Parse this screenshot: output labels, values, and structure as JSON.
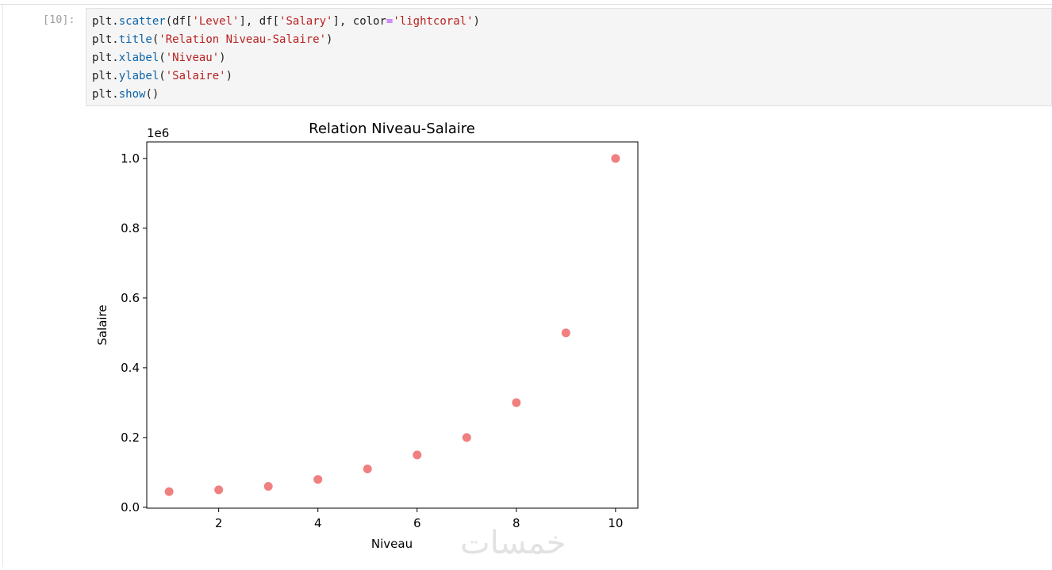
{
  "cell": {
    "prompt": "[10]:",
    "lines": [
      [
        [
          "plt.",
          "plain"
        ],
        [
          "scatter",
          "fn"
        ],
        [
          "(df[",
          "plain"
        ],
        [
          "'Level'",
          "str"
        ],
        [
          "], df[",
          "plain"
        ],
        [
          "'Salary'",
          "str"
        ],
        [
          "], color",
          "plain"
        ],
        [
          "=",
          "op"
        ],
        [
          "'lightcoral'",
          "str"
        ],
        [
          ")",
          "plain"
        ]
      ],
      [
        [
          "plt.",
          "plain"
        ],
        [
          "title",
          "fn"
        ],
        [
          "(",
          "plain"
        ],
        [
          "'Relation Niveau-Salaire'",
          "str"
        ],
        [
          ")",
          "plain"
        ]
      ],
      [
        [
          "plt.",
          "plain"
        ],
        [
          "xlabel",
          "fn"
        ],
        [
          "(",
          "plain"
        ],
        [
          "'Niveau'",
          "str"
        ],
        [
          ")",
          "plain"
        ]
      ],
      [
        [
          "plt.",
          "plain"
        ],
        [
          "ylabel",
          "fn"
        ],
        [
          "(",
          "plain"
        ],
        [
          "'Salaire'",
          "str"
        ],
        [
          ")",
          "plain"
        ]
      ],
      [
        [
          "plt.",
          "plain"
        ],
        [
          "show",
          "fn"
        ],
        [
          "()",
          "plain"
        ]
      ]
    ]
  },
  "chart_data": {
    "type": "scatter",
    "title": "Relation Niveau-Salaire",
    "xlabel": "Niveau",
    "ylabel": "Salaire",
    "y_offset_label": "1e6",
    "x": [
      1,
      2,
      3,
      4,
      5,
      6,
      7,
      8,
      9,
      10
    ],
    "y": [
      45000,
      50000,
      60000,
      80000,
      110000,
      150000,
      200000,
      300000,
      500000,
      1000000
    ],
    "color": "#f08080",
    "xlim": [
      0.55,
      10.45
    ],
    "ylim": [
      -0.0025,
      1.0475
    ],
    "xticks": [
      2,
      4,
      6,
      8,
      10
    ],
    "xtick_labels": [
      "2",
      "4",
      "6",
      "8",
      "10"
    ],
    "yticks": [
      0.0,
      0.2,
      0.4,
      0.6,
      0.8,
      1.0
    ],
    "ytick_labels": [
      "0.0",
      "0.2",
      "0.4",
      "0.6",
      "0.8",
      "1.0"
    ],
    "grid": false
  },
  "watermark": "خمسات"
}
